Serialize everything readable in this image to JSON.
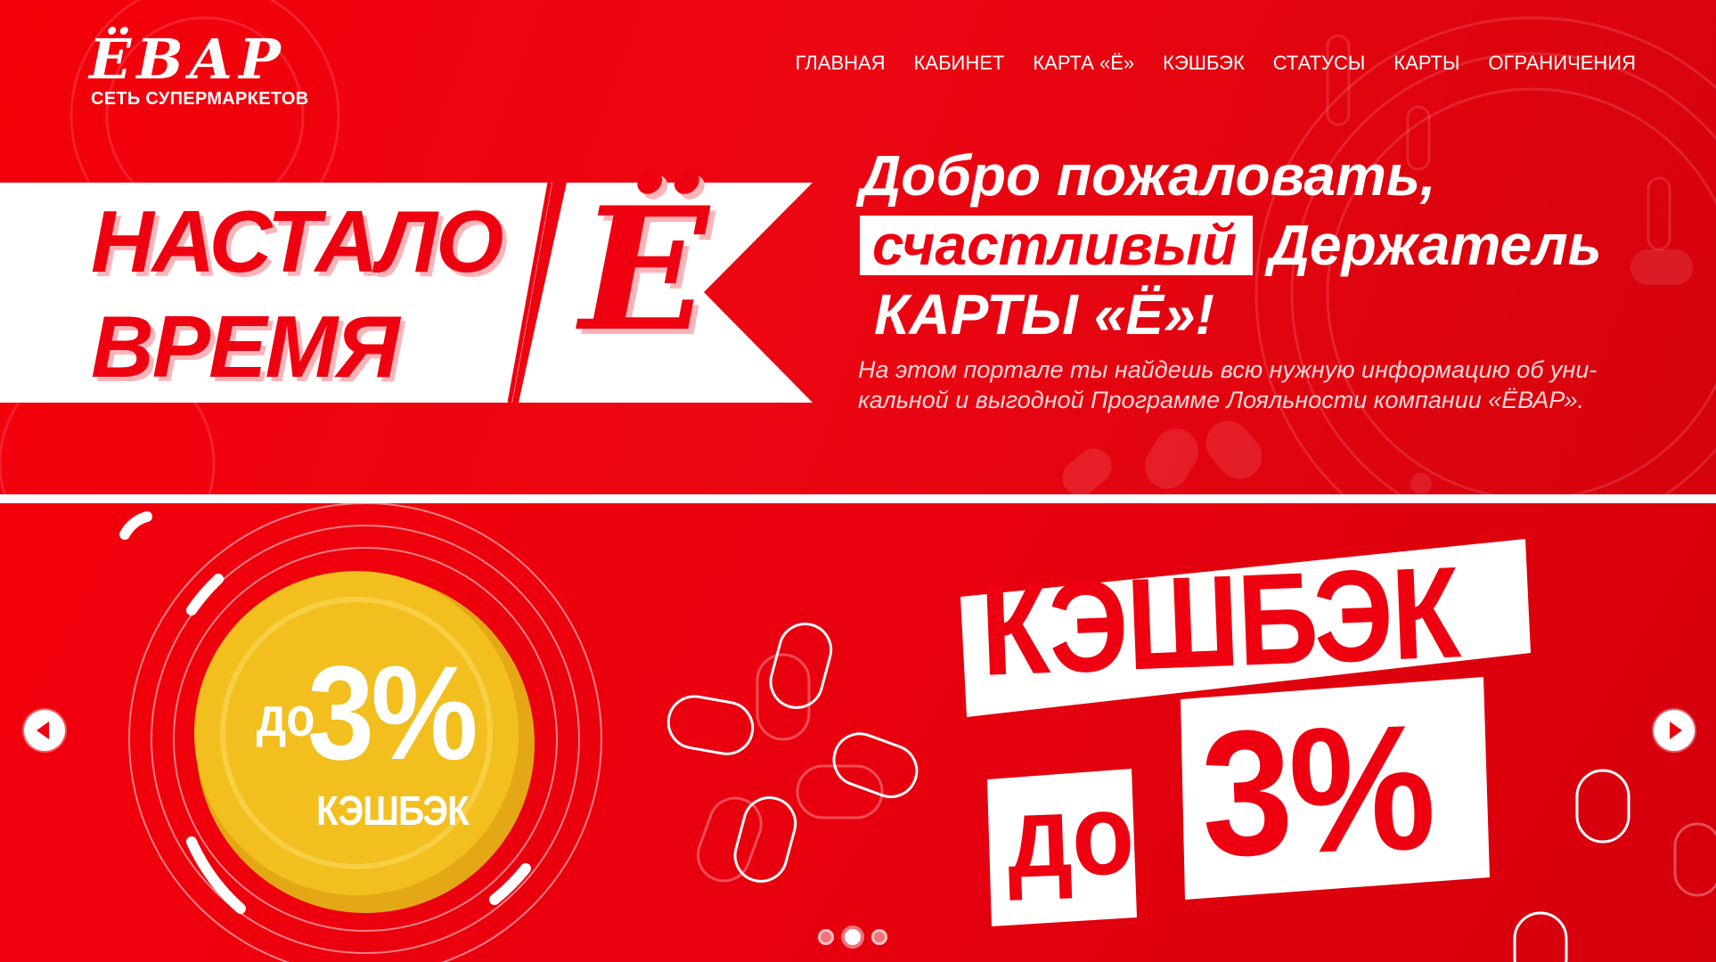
{
  "brand": {
    "logo_text": "ЁВАР",
    "logo_subtitle": "СЕТЬ СУПЕРМАРКЕТОВ"
  },
  "nav": {
    "items": [
      {
        "label": "ГЛАВНАЯ"
      },
      {
        "label": "КАБИНЕТ"
      },
      {
        "label": "КАРТА «Ё»"
      },
      {
        "label": "КЭШБЭК"
      },
      {
        "label": "СТАТУСЫ"
      },
      {
        "label": "КАРТЫ"
      },
      {
        "label": "ОГРАНИЧЕНИЯ"
      }
    ]
  },
  "hero": {
    "ribbon_line1": "НАСТАЛО",
    "ribbon_line2": "ВРЕМЯ",
    "ribbon_glyph": "Ё",
    "welcome_line1": "Добро пожаловать,",
    "welcome_highlight": "счастливый",
    "welcome_line2_rest": "Держатель",
    "welcome_line3": "КАРТЫ «Ё»!",
    "description": "На этом портале ты найдешь всю нужную информацию об уни-кальной и выгодной Программе Лояльности компании «ЁВАР»."
  },
  "slide": {
    "coin_prefix": "до",
    "coin_value": "3%",
    "coin_caption": "КЭШБЭК",
    "title": "КЭШБЭК",
    "value_prefix": "до",
    "value": "3%"
  },
  "slider": {
    "dots_count": 3,
    "active_dot": 2
  },
  "colors": {
    "brand_red": "#ef0010",
    "coin_gold": "#f2bf1f",
    "white": "#ffffff"
  }
}
